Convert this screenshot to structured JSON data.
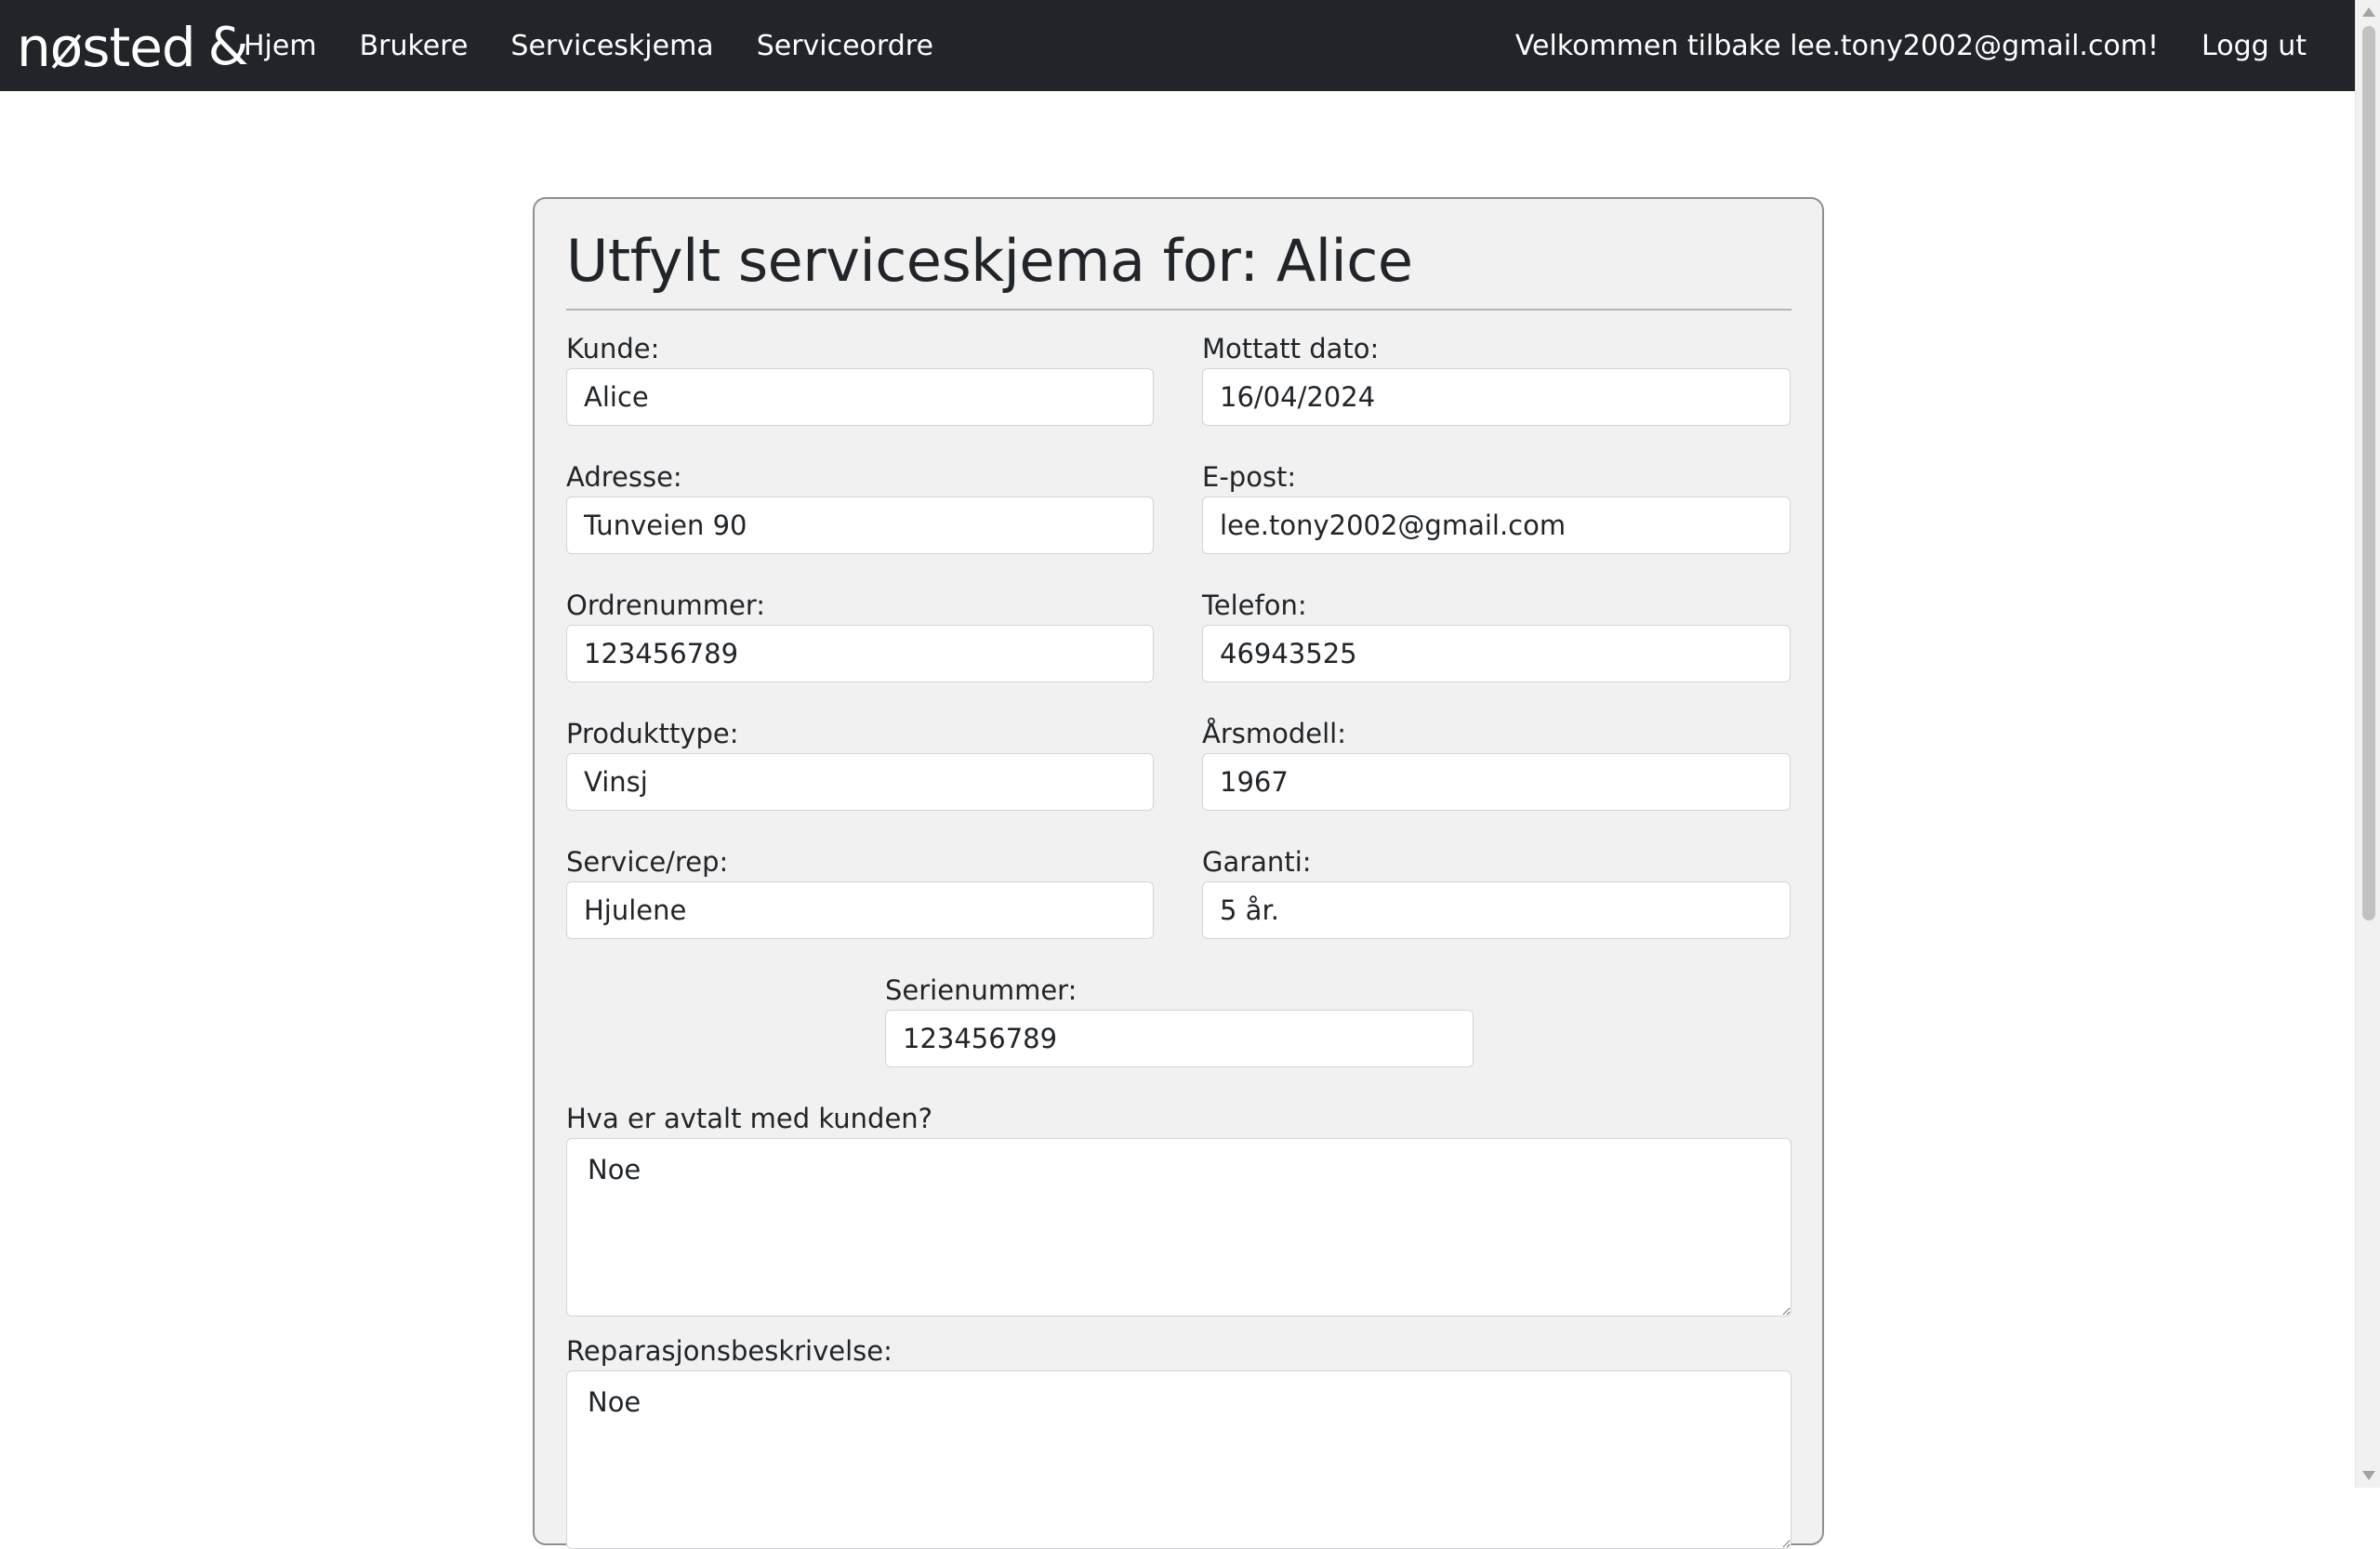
{
  "navbar": {
    "brand": "nøsted",
    "brand_amp": "&",
    "links": [
      "Hjem",
      "Brukere",
      "Serviceskjema",
      "Serviceordre"
    ],
    "welcome": "Velkommen tilbake lee.tony2002@gmail.com!",
    "logout": "Logg ut"
  },
  "form": {
    "title": "Utfylt serviceskjema for: Alice",
    "fields": {
      "kunde": {
        "label": "Kunde:",
        "value": "Alice"
      },
      "mottatt_dato": {
        "label": "Mottatt dato:",
        "value": "16/04/2024"
      },
      "adresse": {
        "label": "Adresse:",
        "value": "Tunveien 90"
      },
      "epost": {
        "label": "E-post:",
        "value": "lee.tony2002@gmail.com"
      },
      "ordrenummer": {
        "label": "Ordrenummer:",
        "value": "123456789"
      },
      "telefon": {
        "label": "Telefon:",
        "value": "46943525"
      },
      "produkttype": {
        "label": "Produkttype:",
        "value": "Vinsj"
      },
      "arsmodell": {
        "label": "Årsmodell:",
        "value": "1967"
      },
      "service_rep": {
        "label": "Service/rep:",
        "value": "Hjulene"
      },
      "garanti": {
        "label": "Garanti:",
        "value": "5 år."
      },
      "serienummer": {
        "label": "Serienummer:",
        "value": "123456789"
      }
    },
    "avtalt": {
      "label": "Hva er avtalt med kunden?",
      "value": "Noe"
    },
    "reparasjon": {
      "label": "Reparasjonsbeskrivelse:",
      "value": "Noe"
    }
  }
}
